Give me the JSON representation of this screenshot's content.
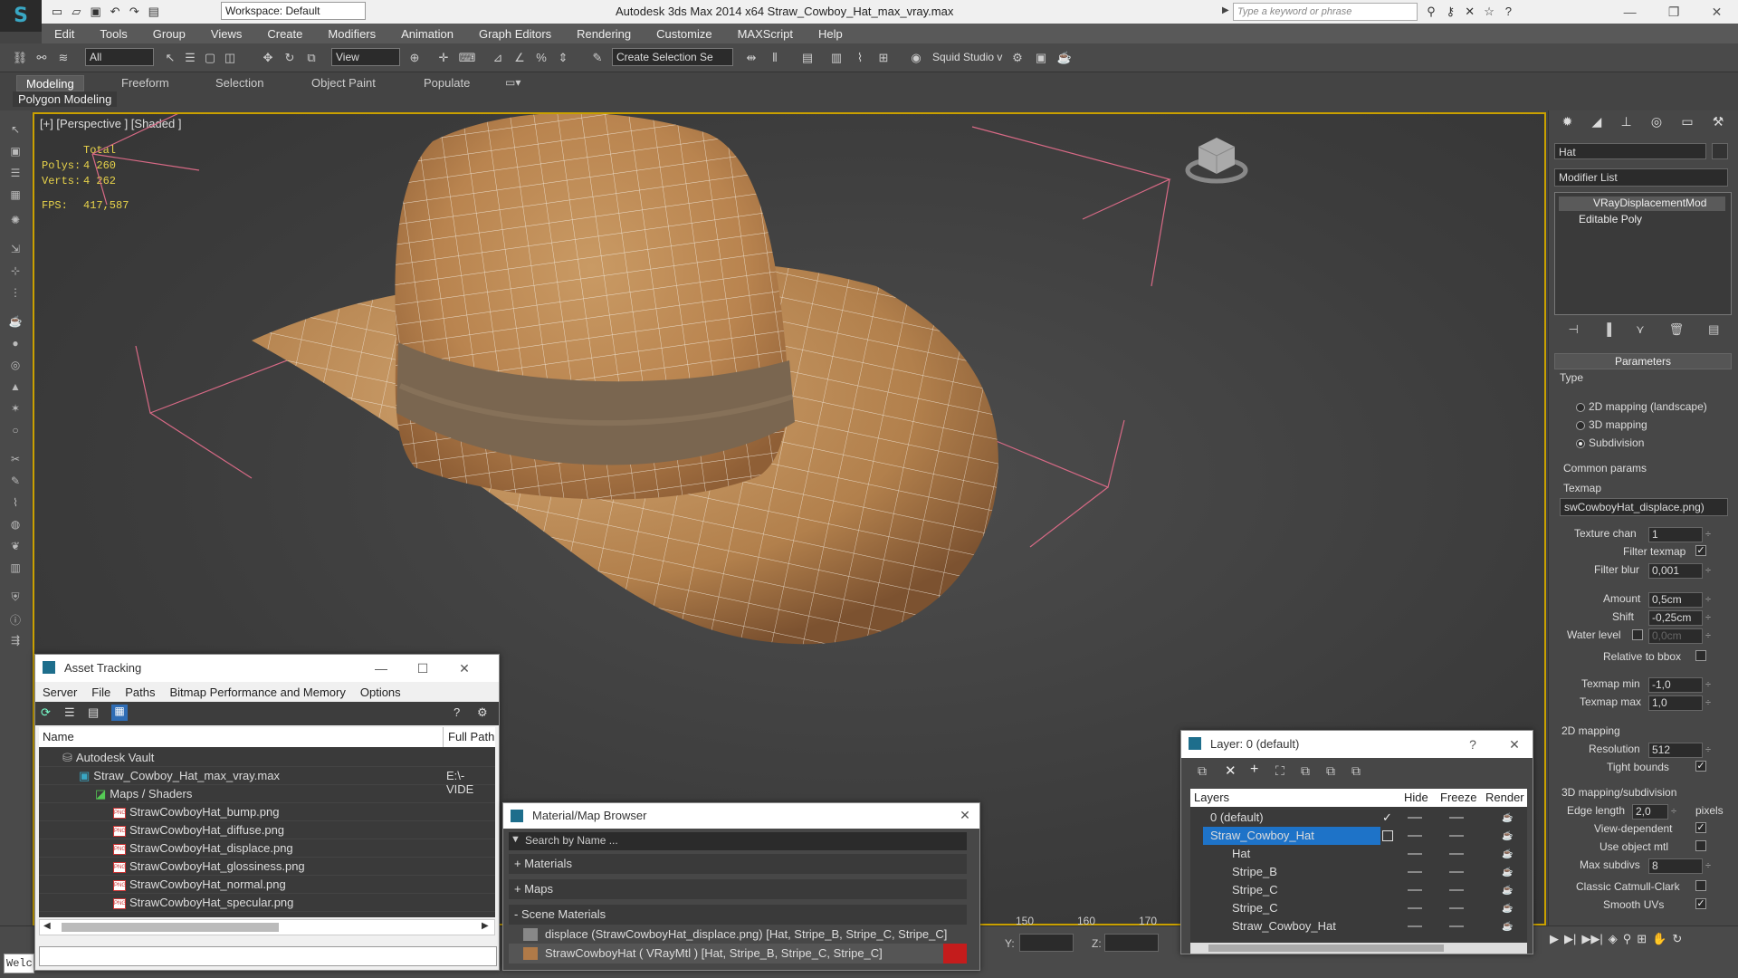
{
  "titlebar": {
    "workspace": "Workspace: Default",
    "app_title": "Autodesk 3ds Max  2014 x64    Straw_Cowboy_Hat_max_vray.max",
    "search_placeholder": "Type a keyword or phrase"
  },
  "menu": [
    "Edit",
    "Tools",
    "Group",
    "Views",
    "Create",
    "Modifiers",
    "Animation",
    "Graph Editors",
    "Rendering",
    "Customize",
    "MAXScript",
    "Help"
  ],
  "toolbar": {
    "selection_filter": "All",
    "ref_coord": "View",
    "selection_set": "Create Selection Se",
    "squid": "Squid Studio v"
  },
  "ribbon": {
    "tabs": [
      "Modeling",
      "Freeform",
      "Selection",
      "Object Paint",
      "Populate"
    ],
    "sub_label": "Polygon Modeling"
  },
  "viewport": {
    "label": "[+] [Perspective ] [Shaded ]",
    "stats": {
      "total_label": "Total",
      "polys_label": "Polys:",
      "polys": "4 260",
      "verts_label": "Verts:",
      "verts": "4 262",
      "fps_label": "FPS:",
      "fps": "417,587"
    }
  },
  "command_panel": {
    "object_name": "Hat",
    "modifier_list": "Modifier List",
    "stack": [
      "VRayDisplacementMod",
      "Editable Poly"
    ],
    "rollout_title": "Parameters",
    "type_label": "Type",
    "type_options": [
      "2D mapping (landscape)",
      "3D mapping",
      "Subdivision"
    ],
    "type_selected": 2,
    "common_label": "Common params",
    "texmap_label": "Texmap",
    "texmap_value": "swCowboyHat_displace.png)",
    "texture_chan_label": "Texture chan",
    "texture_chan": "1",
    "filter_texmap_label": "Filter texmap",
    "filter_blur_label": "Filter blur",
    "filter_blur": "0,001",
    "amount_label": "Amount",
    "amount": "0,5cm",
    "shift_label": "Shift",
    "shift": "-0,25cm",
    "water_label": "Water level",
    "water": "0,0cm",
    "relbbox_label": "Relative to bbox",
    "texmin_label": "Texmap min",
    "texmin": "-1,0",
    "texmax_label": "Texmap max",
    "texmax": "1,0",
    "map2d_label": "2D mapping",
    "resolution_label": "Resolution",
    "resolution": "512",
    "tight_label": "Tight bounds",
    "map3d_label": "3D mapping/subdivision",
    "edge_label": "Edge length",
    "edge": "2,0",
    "pixels_label": "pixels",
    "viewdep_label": "View-dependent",
    "useobj_label": "Use object mtl",
    "maxsub_label": "Max subdivs",
    "maxsub": "8",
    "catmull_label": "Classic Catmull-Clark",
    "smooth_label": "Smooth UVs"
  },
  "asset_tracking": {
    "title": "Asset Tracking",
    "menu": [
      "Server",
      "File",
      "Paths",
      "Bitmap Performance and Memory",
      "Options"
    ],
    "col_name": "Name",
    "col_path": "Full Path",
    "rows": [
      {
        "name": "Autodesk Vault",
        "path": ""
      },
      {
        "name": "Straw_Cowboy_Hat_max_vray.max",
        "path": "E:\\- VIDE"
      },
      {
        "name": "Maps / Shaders",
        "path": ""
      },
      {
        "name": "StrawCowboyHat_bump.png",
        "path": ""
      },
      {
        "name": "StrawCowboyHat_diffuse.png",
        "path": ""
      },
      {
        "name": "StrawCowboyHat_displace.png",
        "path": ""
      },
      {
        "name": "StrawCowboyHat_glossiness.png",
        "path": ""
      },
      {
        "name": "StrawCowboyHat_normal.png",
        "path": ""
      },
      {
        "name": "StrawCowboyHat_specular.png",
        "path": ""
      }
    ]
  },
  "material_browser": {
    "title": "Material/Map Browser",
    "search_placeholder": "Search by Name ...",
    "groups": [
      "+ Materials",
      "+ Maps",
      "- Scene Materials"
    ],
    "items": [
      "displace (StrawCowboyHat_displace.png) [Hat, Stripe_B, Stripe_C, Stripe_C]",
      "StrawCowboyHat  ( VRayMtl )  [Hat, Stripe_B, Stripe_C, Stripe_C]"
    ]
  },
  "layer_window": {
    "title": "Layer: 0 (default)",
    "help": "?",
    "headers": [
      "Layers",
      "Hide",
      "Freeze",
      "Render"
    ],
    "rows": [
      "0 (default)",
      "Straw_Cowboy_Hat",
      "Hat",
      "Stripe_B",
      "Stripe_C",
      "Stripe_C",
      "Straw_Cowboy_Hat"
    ]
  },
  "timeline": {
    "ticks": [
      "150",
      "160",
      "170"
    ],
    "y_label": "Y:",
    "z_label": "Z:",
    "script_text": "Welc"
  },
  "colors": {
    "viewport_border": "#c9a000",
    "stats_text": "#e8d34a",
    "selection_blue": "#1e73c8"
  }
}
